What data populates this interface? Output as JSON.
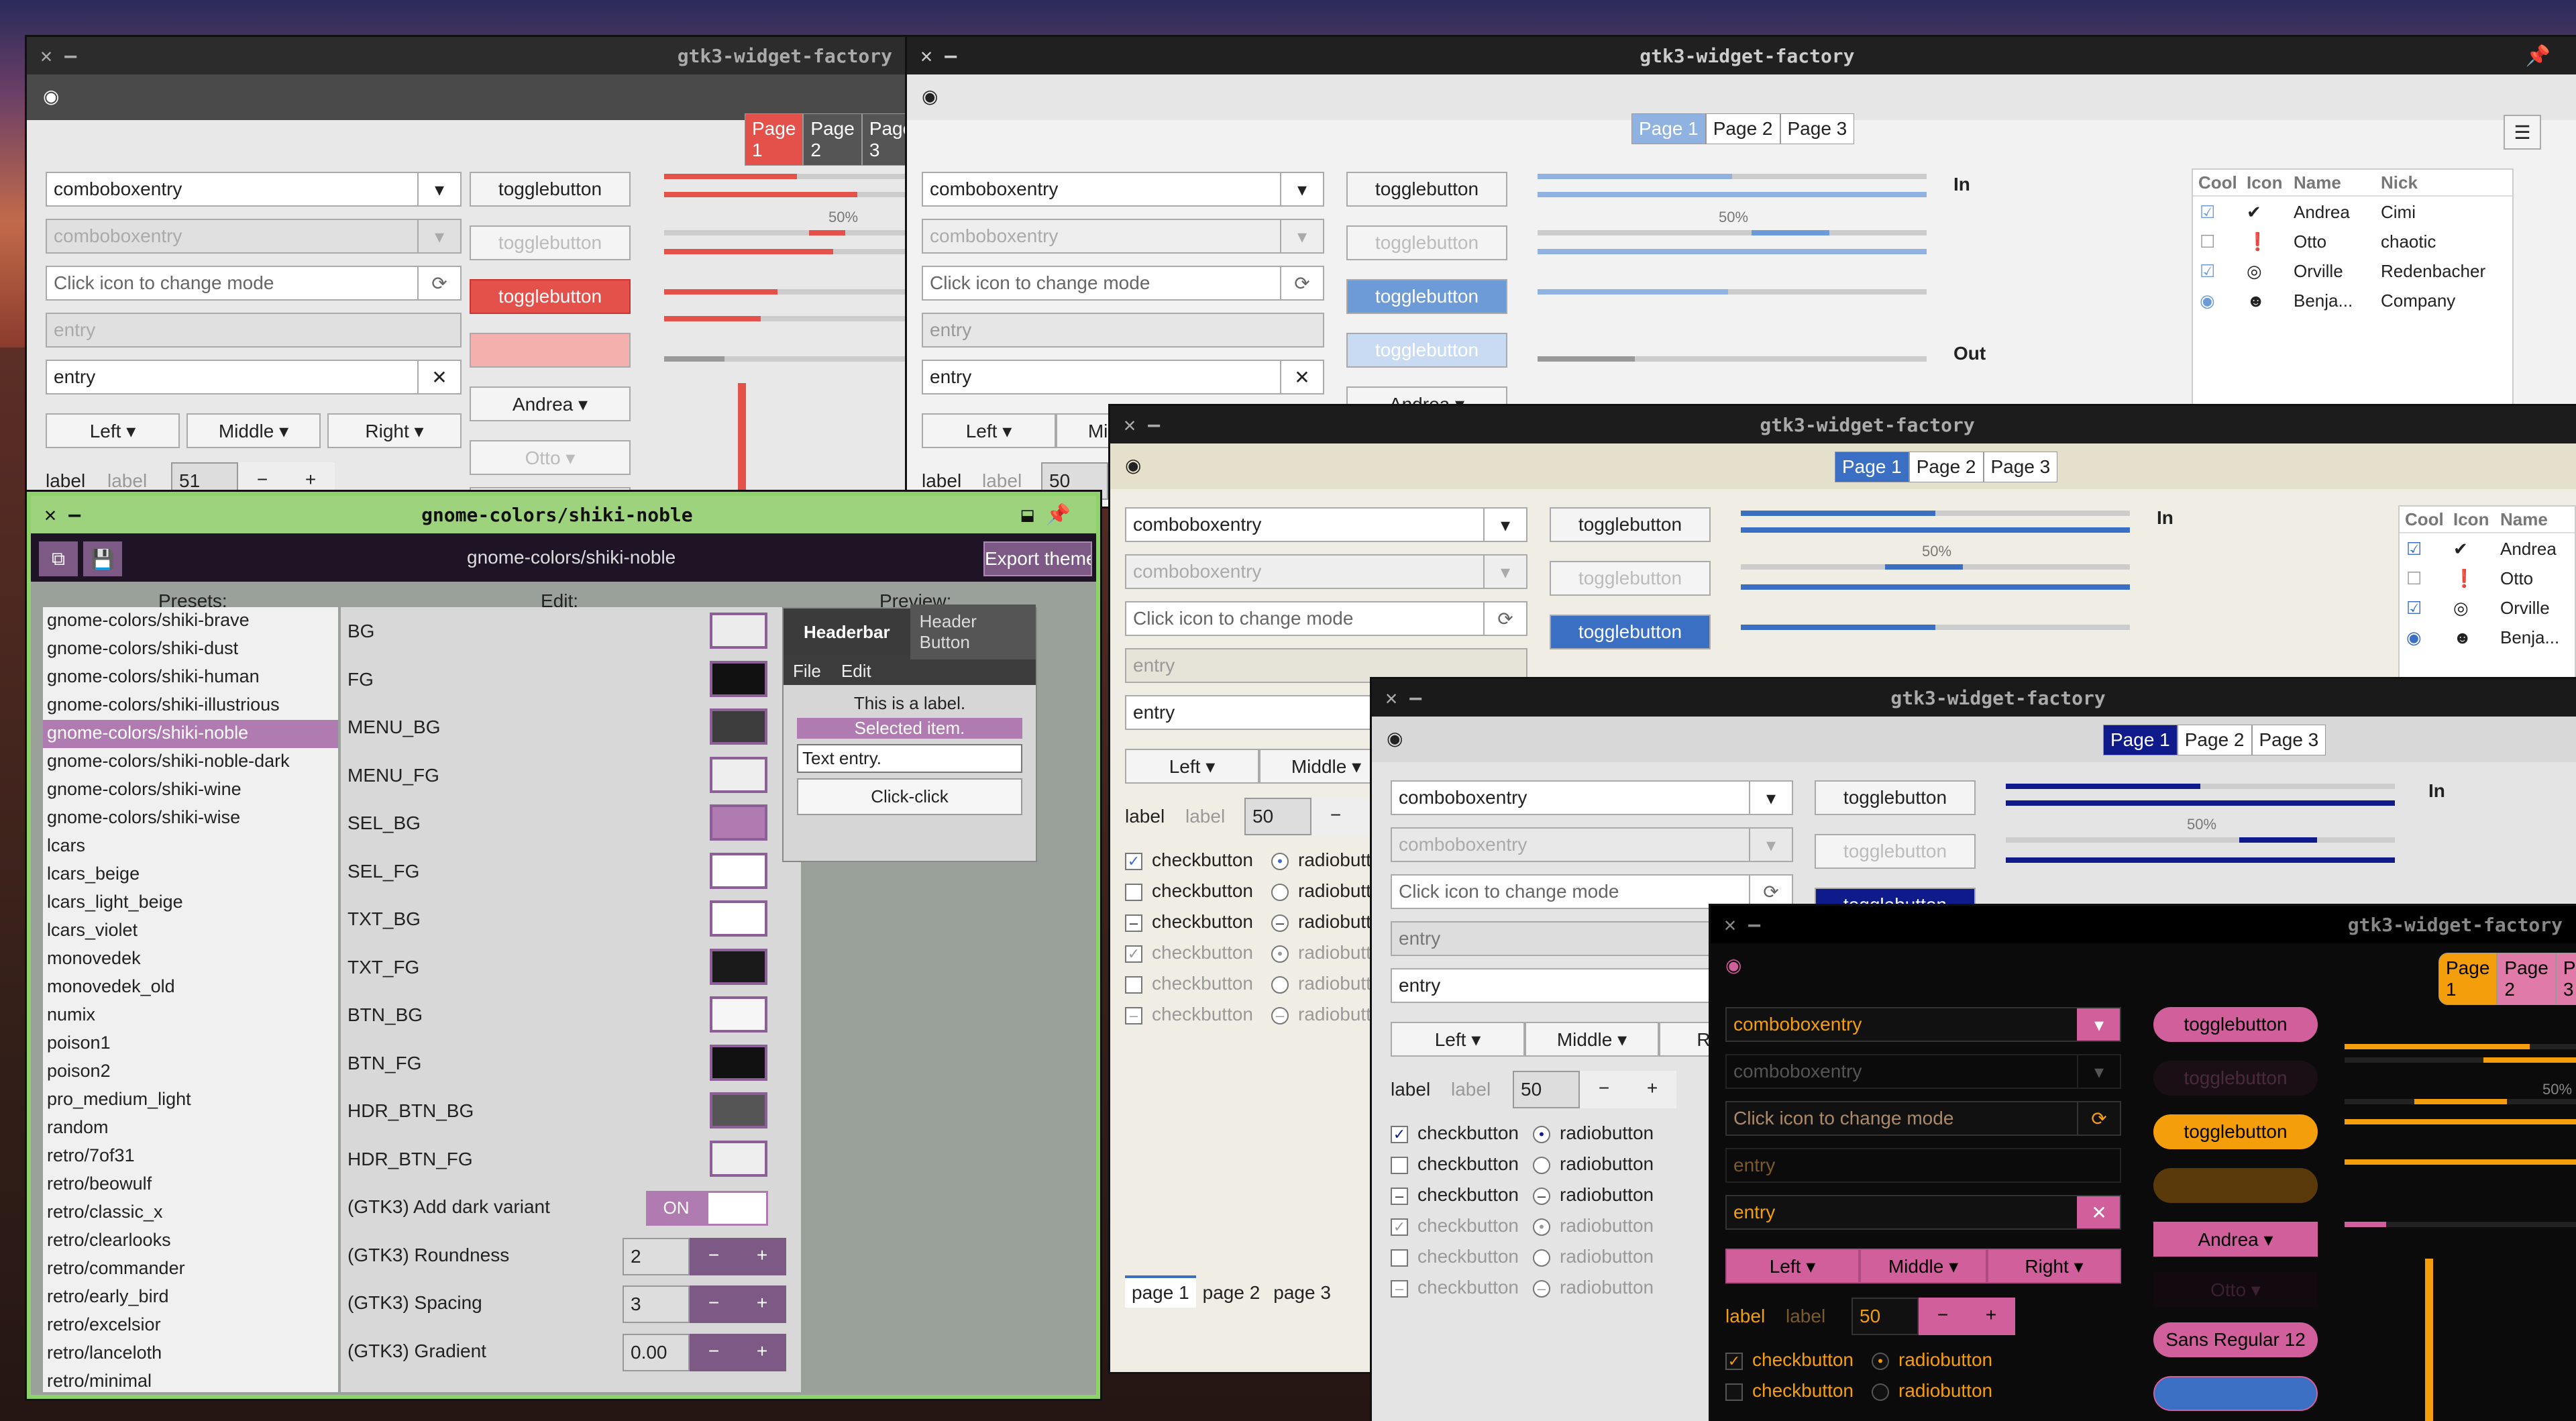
{
  "title_factory": "gtk3-widget-factory",
  "title_theme": "gnome-colors/shiki-noble",
  "tabs": [
    "Page 1",
    "Page 2",
    "Page 3"
  ],
  "combo": "comboboxentry",
  "entry_icon": "Click icon to change mode",
  "entry": "entry",
  "seg": [
    "Left",
    "Middle",
    "Right"
  ],
  "label": "label",
  "spin_a": "51",
  "spin_b": "50",
  "toggle": "togglebutton",
  "andrea": "Andrea",
  "otto": "Otto",
  "font": "Sans Regular",
  "font_size": "12",
  "checkbutton": "checkbutton",
  "radiobutton": "radiobutton",
  "pct": "50%",
  "in": "In",
  "out": "Out",
  "tree": {
    "cols": [
      "Cool",
      "Icon",
      "Name",
      "Nick"
    ],
    "rows": [
      {
        "name": "Andrea",
        "nick": "Cimi",
        "icon": "check-icon"
      },
      {
        "name": "Otto",
        "nick": "chaotic",
        "icon": "alert-icon"
      },
      {
        "name": "Orville",
        "nick": "Redenbacher",
        "icon": "ring-icon"
      },
      {
        "name": "Benja...",
        "nick": "Company",
        "icon": "person-icon"
      }
    ]
  },
  "pages_bottom": [
    "page 1",
    "page 2",
    "page 3"
  ],
  "editor": {
    "title": "gnome-colors/shiki-noble",
    "export": "Export theme",
    "presets_label": "Presets:",
    "edit_label": "Edit:",
    "preview_label": "Preview:",
    "presets": [
      "gnome-colors/shiki-brave",
      "gnome-colors/shiki-dust",
      "gnome-colors/shiki-human",
      "gnome-colors/shiki-illustrious",
      "gnome-colors/shiki-noble",
      "gnome-colors/shiki-noble-dark",
      "gnome-colors/shiki-wine",
      "gnome-colors/shiki-wise",
      "lcars",
      "lcars_beige",
      "lcars_light_beige",
      "lcars_violet",
      "monovedek",
      "monovedek_old",
      "numix",
      "poison1",
      "poison2",
      "pro_medium_light",
      "random",
      "retro/7of31",
      "retro/beowulf",
      "retro/classic_x",
      "retro/clearlooks",
      "retro/commander",
      "retro/early_bird",
      "retro/excelsior",
      "retro/lanceloth",
      "retro/minimal"
    ],
    "selected_index": 4,
    "fields": [
      {
        "name": "BG",
        "color": "#ececec"
      },
      {
        "name": "FG",
        "color": "#111111"
      },
      {
        "name": "MENU_BG",
        "color": "#3c3c3c"
      },
      {
        "name": "MENU_FG",
        "color": "#eeeeee"
      },
      {
        "name": "SEL_BG",
        "color": "#b07bb0"
      },
      {
        "name": "SEL_FG",
        "color": "#ffffff"
      },
      {
        "name": "TXT_BG",
        "color": "#ffffff"
      },
      {
        "name": "TXT_FG",
        "color": "#1a1a1a"
      },
      {
        "name": "BTN_BG",
        "color": "#f6f6f6"
      },
      {
        "name": "BTN_FG",
        "color": "#111111"
      },
      {
        "name": "HDR_BTN_BG",
        "color": "#555555"
      },
      {
        "name": "HDR_BTN_FG",
        "color": "#eeeeee"
      }
    ],
    "dark_label": "(GTK3) Add dark variant",
    "dark_state": "ON",
    "roundness_label": "(GTK3) Roundness",
    "roundness": "2",
    "spacing_label": "(GTK3) Spacing",
    "spacing": "3",
    "gradient_label": "(GTK3) Gradient",
    "gradient": "0.00",
    "preview": {
      "headerbar": "Headerbar",
      "header_button": "Header Button",
      "menu": [
        "File",
        "Edit"
      ],
      "label": "This is a label.",
      "selected": "Selected item.",
      "entry": "Text entry.",
      "button": "Click-click"
    }
  }
}
